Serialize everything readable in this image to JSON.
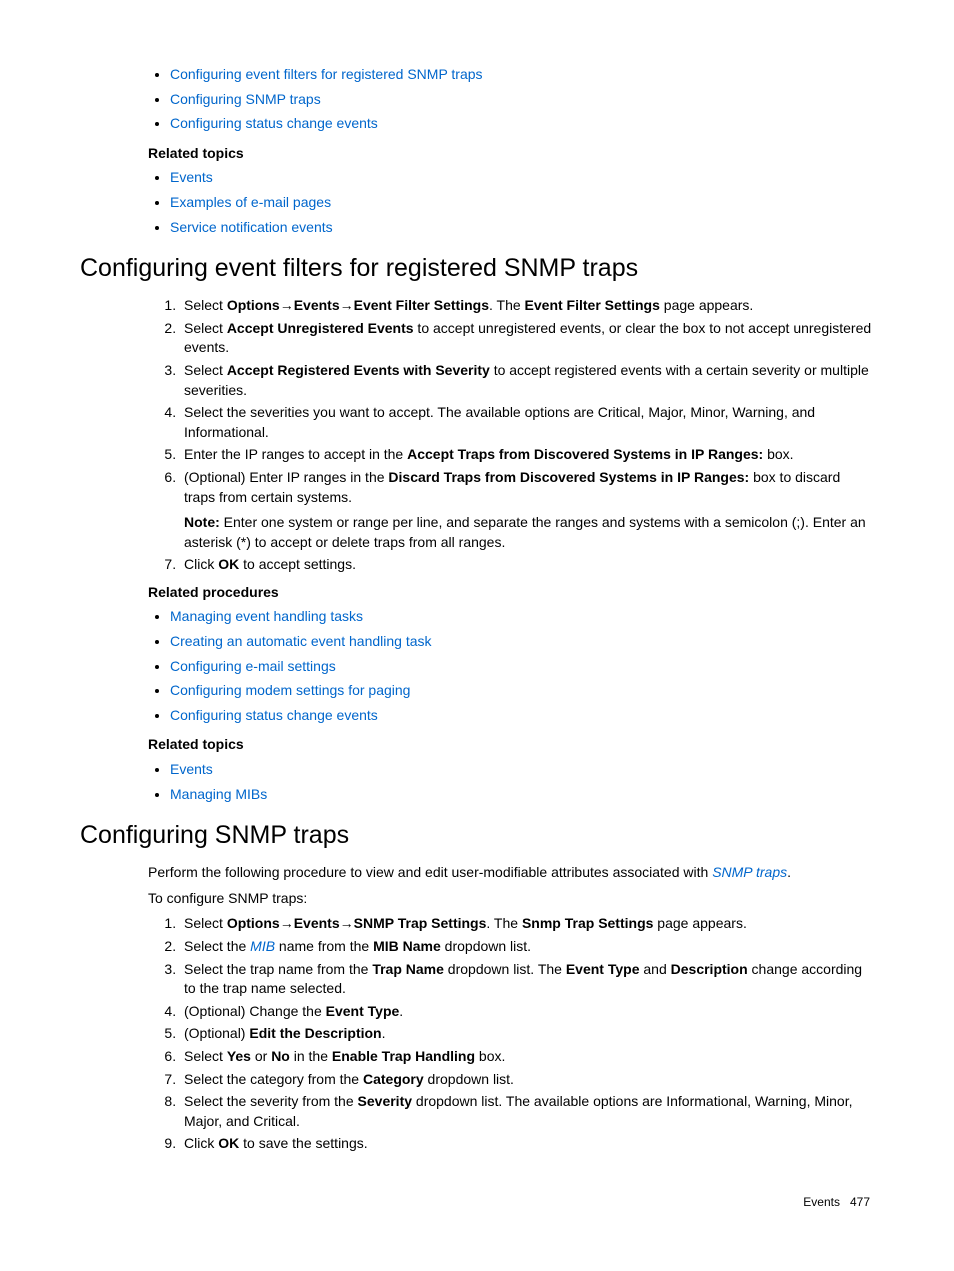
{
  "top_links": [
    "Configuring event filters for registered SNMP traps",
    "Configuring SNMP traps",
    "Configuring status change events"
  ],
  "related_topics_label": "Related topics",
  "related_procedures_label": "Related procedures",
  "top_related_topics": [
    "Events",
    "Examples of e-mail pages",
    "Service notification events"
  ],
  "section1": {
    "heading": "Configuring event filters for registered SNMP traps",
    "steps": {
      "s1_pre": "Select ",
      "s1_b1": "Options",
      "s1_arrow": "→",
      "s1_b2": "Events",
      "s1_b3": "Event Filter Settings",
      "s1_mid": ". The ",
      "s1_b4": "Event Filter Settings",
      "s1_post": " page appears.",
      "s2_pre": "Select ",
      "s2_b1": "Accept Unregistered Events",
      "s2_post": " to accept unregistered events, or clear the box to not accept unregistered events.",
      "s3_pre": "Select ",
      "s3_b1": "Accept Registered Events with Severity",
      "s3_post": " to accept registered events with a certain severity or multiple severities.",
      "s4": "Select the severities you want to accept. The available options are Critical, Major, Minor, Warning, and Informational.",
      "s5_pre": "Enter the IP ranges to accept in the ",
      "s5_b1": "Accept Traps from Discovered Systems in IP Ranges:",
      "s5_post": " box.",
      "s6_pre": "(Optional) Enter IP ranges in the ",
      "s6_b1": "Discard Traps from Discovered Systems in IP Ranges:",
      "s6_post": " box to discard traps from certain systems.",
      "s6_note_b": "Note:",
      "s6_note": " Enter one system or range per line, and separate the ranges and systems with a semicolon (;). Enter an asterisk (*) to accept or delete traps from all ranges.",
      "s7_pre": "Click ",
      "s7_b1": "OK",
      "s7_post": " to accept settings."
    },
    "related_procedures": [
      "Managing event handling tasks",
      "Creating an automatic event handling task",
      "Configuring e-mail settings",
      "Configuring modem settings for paging",
      "Configuring status change events"
    ],
    "related_topics": [
      "Events",
      "Managing MIBs"
    ]
  },
  "section2": {
    "heading": "Configuring SNMP traps",
    "intro_pre": "Perform the following procedure to view and edit user-modifiable attributes associated with ",
    "intro_link": "SNMP traps",
    "intro_post": ".",
    "intro2": "To configure SNMP traps:",
    "steps": {
      "s1_pre": "Select ",
      "s1_b1": "Options",
      "s1_arrow": "→",
      "s1_b2": "Events",
      "s1_b3": "SNMP Trap Settings",
      "s1_mid": ". The ",
      "s1_b4": "Snmp Trap Settings",
      "s1_post": " page appears.",
      "s2_pre": "Select the ",
      "s2_link": "MIB",
      "s2_mid": " name from the ",
      "s2_b1": "MIB Name",
      "s2_post": " dropdown list.",
      "s3_pre": "Select the trap name from the ",
      "s3_b1": "Trap Name",
      "s3_mid": " dropdown list. The ",
      "s3_b2": "Event Type",
      "s3_and": " and ",
      "s3_b3": "Description",
      "s3_post": " change according to the trap name selected.",
      "s4_pre": "(Optional) Change the ",
      "s4_b1": "Event Type",
      "s4_post": ".",
      "s5_pre": "(Optional) ",
      "s5_b1": "Edit the Description",
      "s5_post": ".",
      "s6_pre": "Select ",
      "s6_b1": "Yes",
      "s6_or": " or ",
      "s6_b2": "No",
      "s6_mid": " in the ",
      "s6_b3": "Enable Trap Handling",
      "s6_post": " box.",
      "s7_pre": "Select the category from the ",
      "s7_b1": "Category",
      "s7_post": " dropdown list.",
      "s8_pre": "Select the severity from the ",
      "s8_b1": "Severity",
      "s8_post": " dropdown list. The available options are Informational, Warning, Minor, Major, and Critical.",
      "s9_pre": "Click ",
      "s9_b1": "OK",
      "s9_post": " to save the settings."
    }
  },
  "footer_label": "Events",
  "footer_page": "477"
}
